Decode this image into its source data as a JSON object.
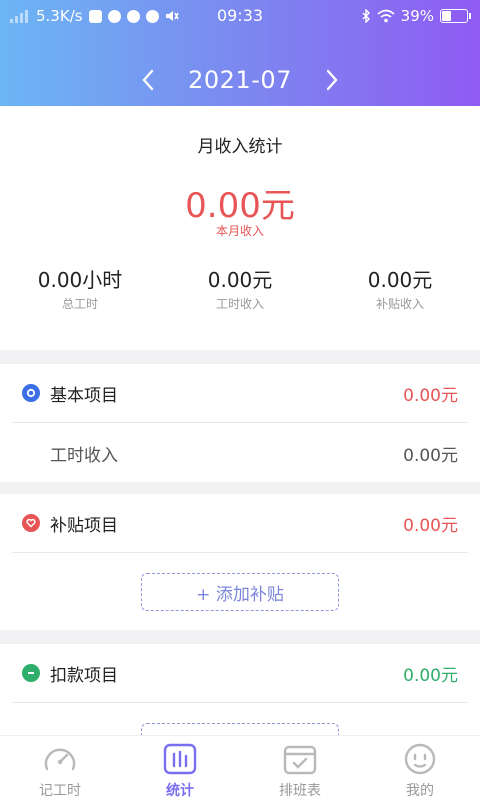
{
  "status_bar": {
    "net_speed": "5.3K/s",
    "time": "09:33",
    "battery": "39%",
    "battery_level": 0.39
  },
  "header": {
    "month": "2021-07",
    "prev_icon": "chevron-left-icon",
    "next_icon": "chevron-right-icon"
  },
  "summary": {
    "title": "月收入统计",
    "total": "0.00元",
    "total_label": "本月收入",
    "stats": [
      {
        "value": "0.00小时",
        "label": "总工时"
      },
      {
        "value": "0.00元",
        "label": "工时收入"
      },
      {
        "value": "0.00元",
        "label": "补贴收入"
      }
    ]
  },
  "basic": {
    "title": "基本项目",
    "amount": "0.00元",
    "row_label": "工时收入",
    "row_value": "0.00元",
    "color": "#3b6fe5"
  },
  "subsidy": {
    "title": "补贴项目",
    "amount": "0.00元",
    "add_label": "+ 添加补贴",
    "color": "#e85556"
  },
  "deduction": {
    "title": "扣款项目",
    "amount": "0.00元",
    "color": "#2fae6b"
  },
  "tabs": [
    {
      "label": "记工时",
      "icon": "clock-gauge-icon"
    },
    {
      "label": "统计",
      "icon": "bar-chart-icon"
    },
    {
      "label": "排班表",
      "icon": "calendar-check-icon"
    },
    {
      "label": "我的",
      "icon": "face-icon"
    }
  ]
}
